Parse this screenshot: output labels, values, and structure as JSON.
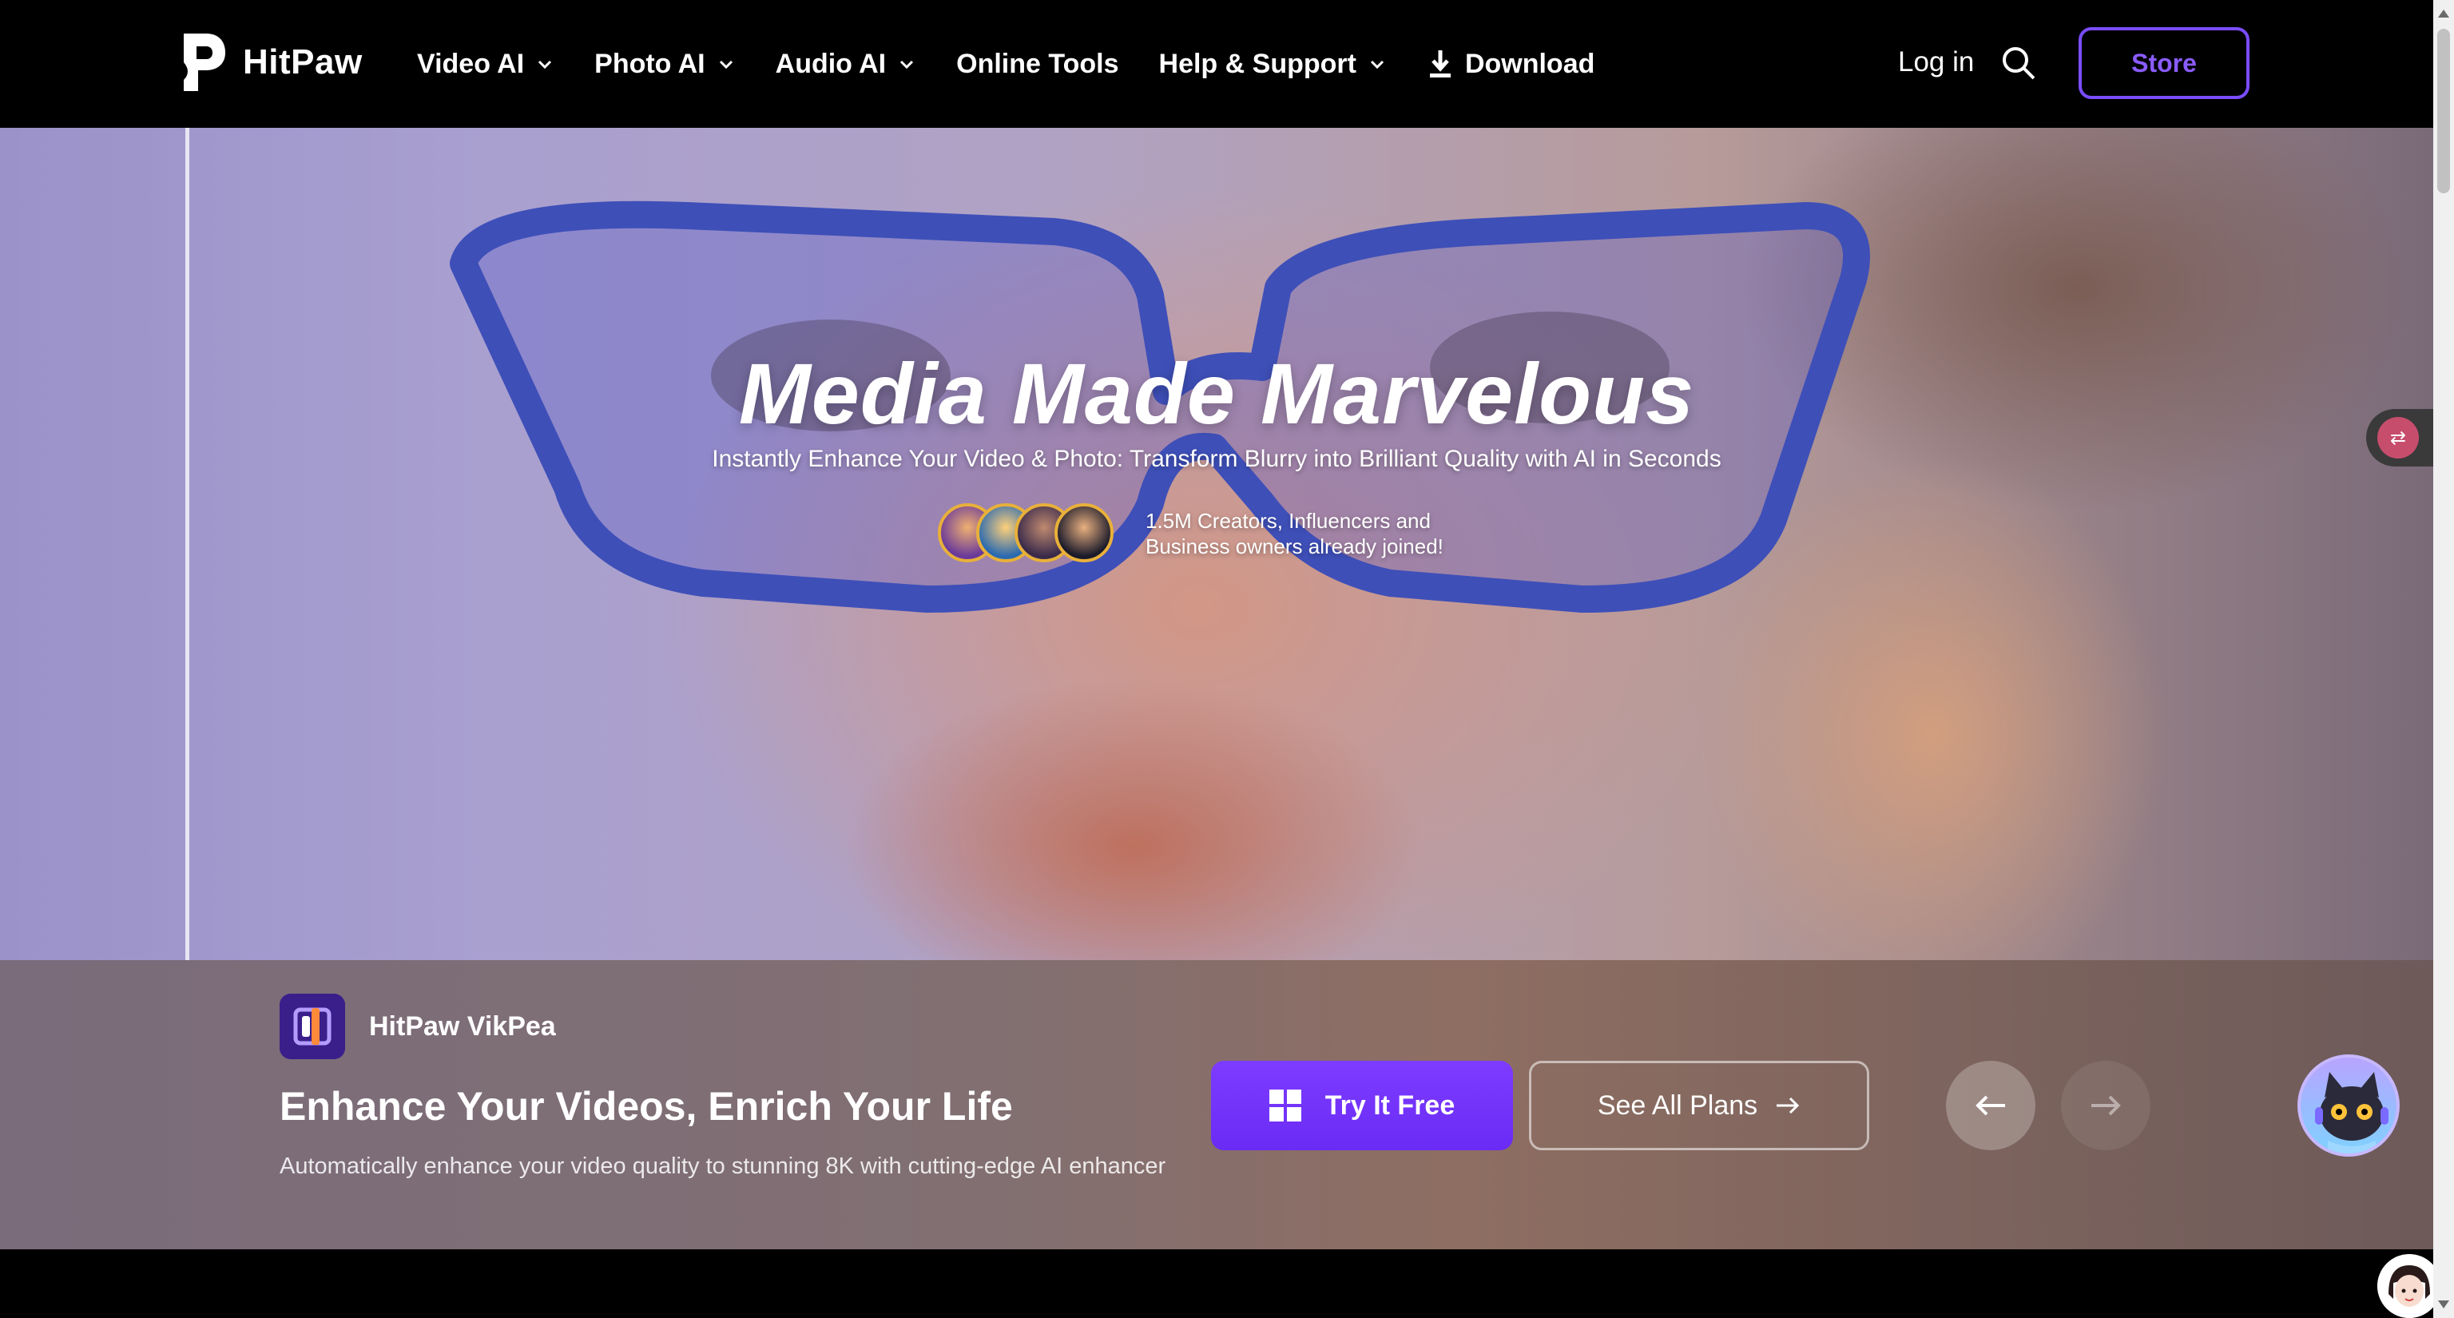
{
  "header": {
    "logo_text": "HitPaw",
    "nav": [
      {
        "label": "Video AI",
        "dropdown": true
      },
      {
        "label": "Photo AI",
        "dropdown": true
      },
      {
        "label": "Audio AI",
        "dropdown": true
      },
      {
        "label": "Online Tools",
        "dropdown": false
      },
      {
        "label": "Help & Support",
        "dropdown": true
      }
    ],
    "download_label": "Download",
    "login_label": "Log in",
    "store_label": "Store"
  },
  "hero": {
    "title": "Media Made Marvelous",
    "subtitle": "Instantly Enhance Your Video & Photo: Transform Blurry into Brilliant Quality with AI in Seconds",
    "joined_line1": "1.5M Creators, Influencers and",
    "joined_line2": "Business owners already joined!"
  },
  "product": {
    "name": "HitPaw VikPea",
    "headline": "Enhance Your Videos, Enrich Your Life",
    "description": "Automatically enhance your video quality to stunning 8K with cutting-edge AI enhancer",
    "try_label": "Try It Free",
    "plans_label": "See All Plans"
  },
  "icons": {
    "translate": "translate-icon",
    "search": "search-icon",
    "windows": "windows-icon"
  },
  "colors": {
    "accent": "#7a4dff",
    "try_button": "#6a2bf5"
  }
}
